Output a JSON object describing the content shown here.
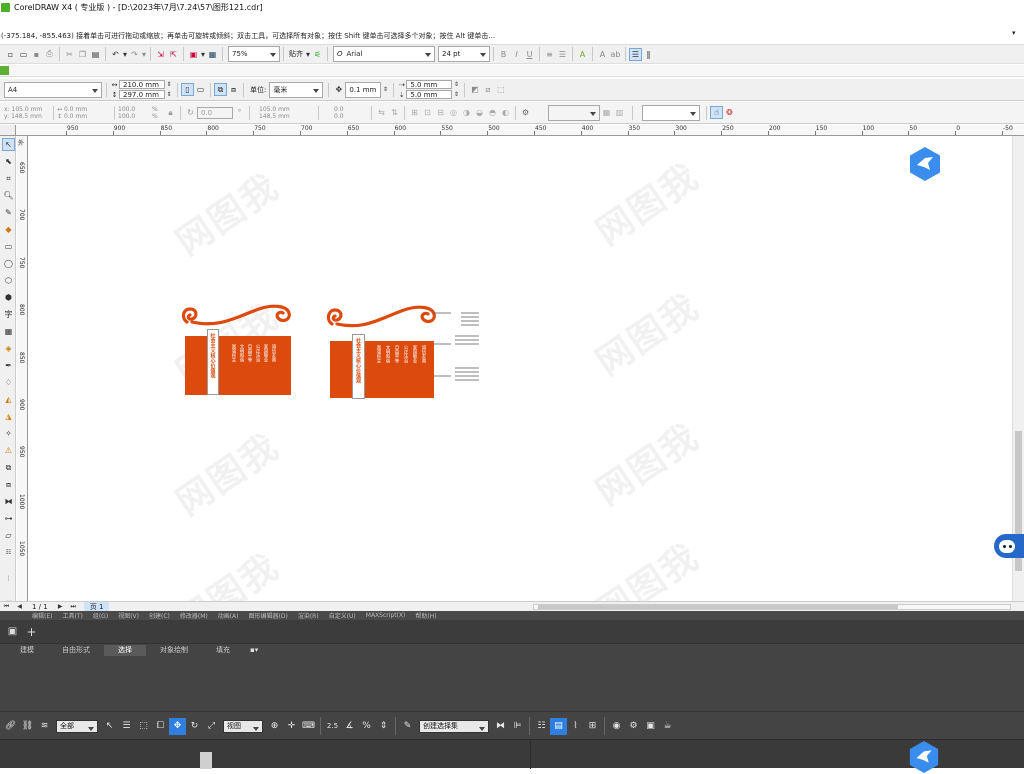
{
  "title": {
    "text": "CorelDRAW X4 ( 专业版 ) - [D:\\2023年\\7月\\7.24\\57\\图形121.cdr]"
  },
  "status": {
    "text": "(-375.184, -855.463)  接着单击可进行拖动或缩放；再单击可旋转或倾斜；双击工具，可选择所有对象；按住 Shift 键单击可选择多个对象；按住 Alt 键单击..."
  },
  "toolbar": {
    "zoom": "75%",
    "snap_label": "贴齐",
    "font_name": "Arial",
    "font_size": "24 pt"
  },
  "propbar": {
    "page_size": "A4",
    "width": "210.0 mm",
    "height": "297.0 mm",
    "unit_label": "单位:",
    "unit": "毫米",
    "nudge": "0.1 mm",
    "dup_x": "5.0 mm",
    "dup_y": "5.0 mm"
  },
  "objbar": {
    "x": "105.0 mm",
    "y": "148.5 mm",
    "w": "0.0 mm",
    "h": "0.0 mm",
    "sx": "100.0",
    "sy": "100.0",
    "angle": "0.0",
    "cx": "105.0 mm",
    "cy": "148.5 mm",
    "px": "0.0",
    "py": "0.0",
    "pct": "%"
  },
  "ruler": {
    "h_labels": [
      "950",
      "900",
      "850",
      "800",
      "750",
      "700",
      "650",
      "600",
      "550",
      "500",
      "450",
      "400",
      "350",
      "300",
      "250",
      "200",
      "150",
      "100",
      "50",
      "0",
      "-50",
      "-575 米"
    ],
    "v_labels": [
      "650",
      "700",
      "750",
      "800",
      "850",
      "900",
      "950",
      "1000",
      "1050"
    ],
    "v_top": "外"
  },
  "design": {
    "text_small": "社会主义核心价值观",
    "text_big": "社会主义核心价值观",
    "cols_left": [
      "富强民主",
      "文明和谐",
      "自由平等",
      "公正法治",
      "爱国敬业",
      "诚信友善"
    ],
    "cols_right": [
      "富强民主",
      "文明和谐",
      "自由平等",
      "公正法治",
      "爱国敬业",
      "诚信友善"
    ]
  },
  "pagenav": {
    "counter": "1 / 1",
    "page_tab": "页 1"
  },
  "menu_strip": {
    "items": [
      "编辑(E)",
      "工具(T)",
      "组(G)",
      "视图(V)",
      "创建(C)",
      "修改器(M)",
      "动画(A)",
      "图形编辑器(D)",
      "渲染(R)",
      "自定义(U)",
      "MAXScript(X)",
      "帮助(H)"
    ]
  },
  "max": {
    "tabs": [
      "建模",
      "自由形式",
      "选择",
      "对象绘制",
      "填充"
    ],
    "filter": "全部",
    "view": "视图",
    "selection_set": "创建选择集"
  },
  "colors": {
    "orange": "#dd4a0d",
    "dark_panel": "#444444",
    "accent_blue": "#2f7fe0"
  }
}
